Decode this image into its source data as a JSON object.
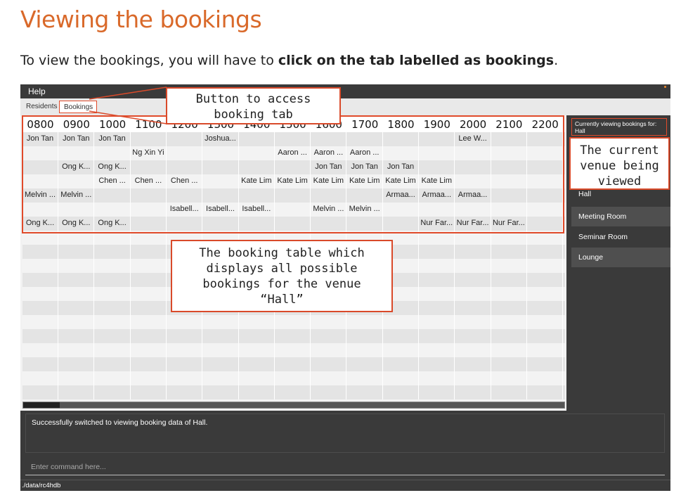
{
  "doc": {
    "title": "Viewing the bookings",
    "para_prefix": "To view the bookings, you will have to ",
    "para_bold": "click on the tab labelled as bookings",
    "para_suffix": "."
  },
  "app": {
    "menu": {
      "help": "Help"
    },
    "tabs": [
      {
        "label": "Residents",
        "active": false
      },
      {
        "label": "Bookings",
        "active": true
      }
    ],
    "table": {
      "hours": [
        "0800",
        "0900",
        "1000",
        "1100",
        "1200",
        "1300",
        "1400",
        "1500",
        "1600",
        "1700",
        "1800",
        "1900",
        "2000",
        "2100",
        "2200"
      ],
      "rows": [
        [
          "Jon Tan",
          "Jon Tan",
          "Jon Tan",
          "",
          "",
          "Joshua...",
          "",
          "",
          "",
          "",
          "",
          "",
          "Lee W...",
          "",
          ""
        ],
        [
          "",
          "",
          "",
          "Ng Xin Yi",
          "",
          "",
          "",
          "Aaron ...",
          "Aaron ...",
          "Aaron ...",
          "",
          "",
          "",
          "",
          ""
        ],
        [
          "",
          "Ong K...",
          "Ong K...",
          "",
          "",
          "",
          "",
          "",
          "Jon Tan",
          "Jon Tan",
          "Jon Tan",
          "",
          "",
          "",
          ""
        ],
        [
          "",
          "",
          "Chen ...",
          "Chen ...",
          "Chen ...",
          "",
          "Kate Lim",
          "Kate Lim",
          "Kate Lim",
          "Kate Lim",
          "Kate Lim",
          "Kate Lim",
          "",
          "",
          ""
        ],
        [
          "Melvin ...",
          "Melvin ...",
          "",
          "",
          "",
          "",
          "",
          "",
          "",
          "",
          "Armaa...",
          "Armaa...",
          "Armaa...",
          "",
          ""
        ],
        [
          "",
          "",
          "",
          "",
          "Isabell...",
          "Isabell...",
          "Isabell...",
          "",
          "Melvin ...",
          "Melvin ...",
          "",
          "",
          "",
          "",
          ""
        ],
        [
          "Ong K...",
          "Ong K...",
          "Ong K...",
          "",
          "",
          "",
          "",
          "",
          "",
          "",
          "",
          "Nur Far...",
          "Nur Far...",
          "Nur Far...",
          ""
        ]
      ],
      "empty_rows": 12
    },
    "sidebar": {
      "header": "Currently viewing bookings for: Hall",
      "venues": [
        "Hall",
        "Meeting Room",
        "Seminar Room",
        "Lounge"
      ]
    },
    "result": "Successfully switched to viewing booking data of Hall.",
    "command_placeholder": "Enter command here...",
    "status": "./data/rc4hdb"
  },
  "callouts": {
    "tab": "Button to access booking tab",
    "venue": "The current venue being viewed",
    "table": "The booking table which displays all possible bookings for the venue “Hall”"
  },
  "colors": {
    "accent": "#d9692a",
    "highlight": "#e04a2a",
    "app_bg": "#3a3a3a"
  }
}
